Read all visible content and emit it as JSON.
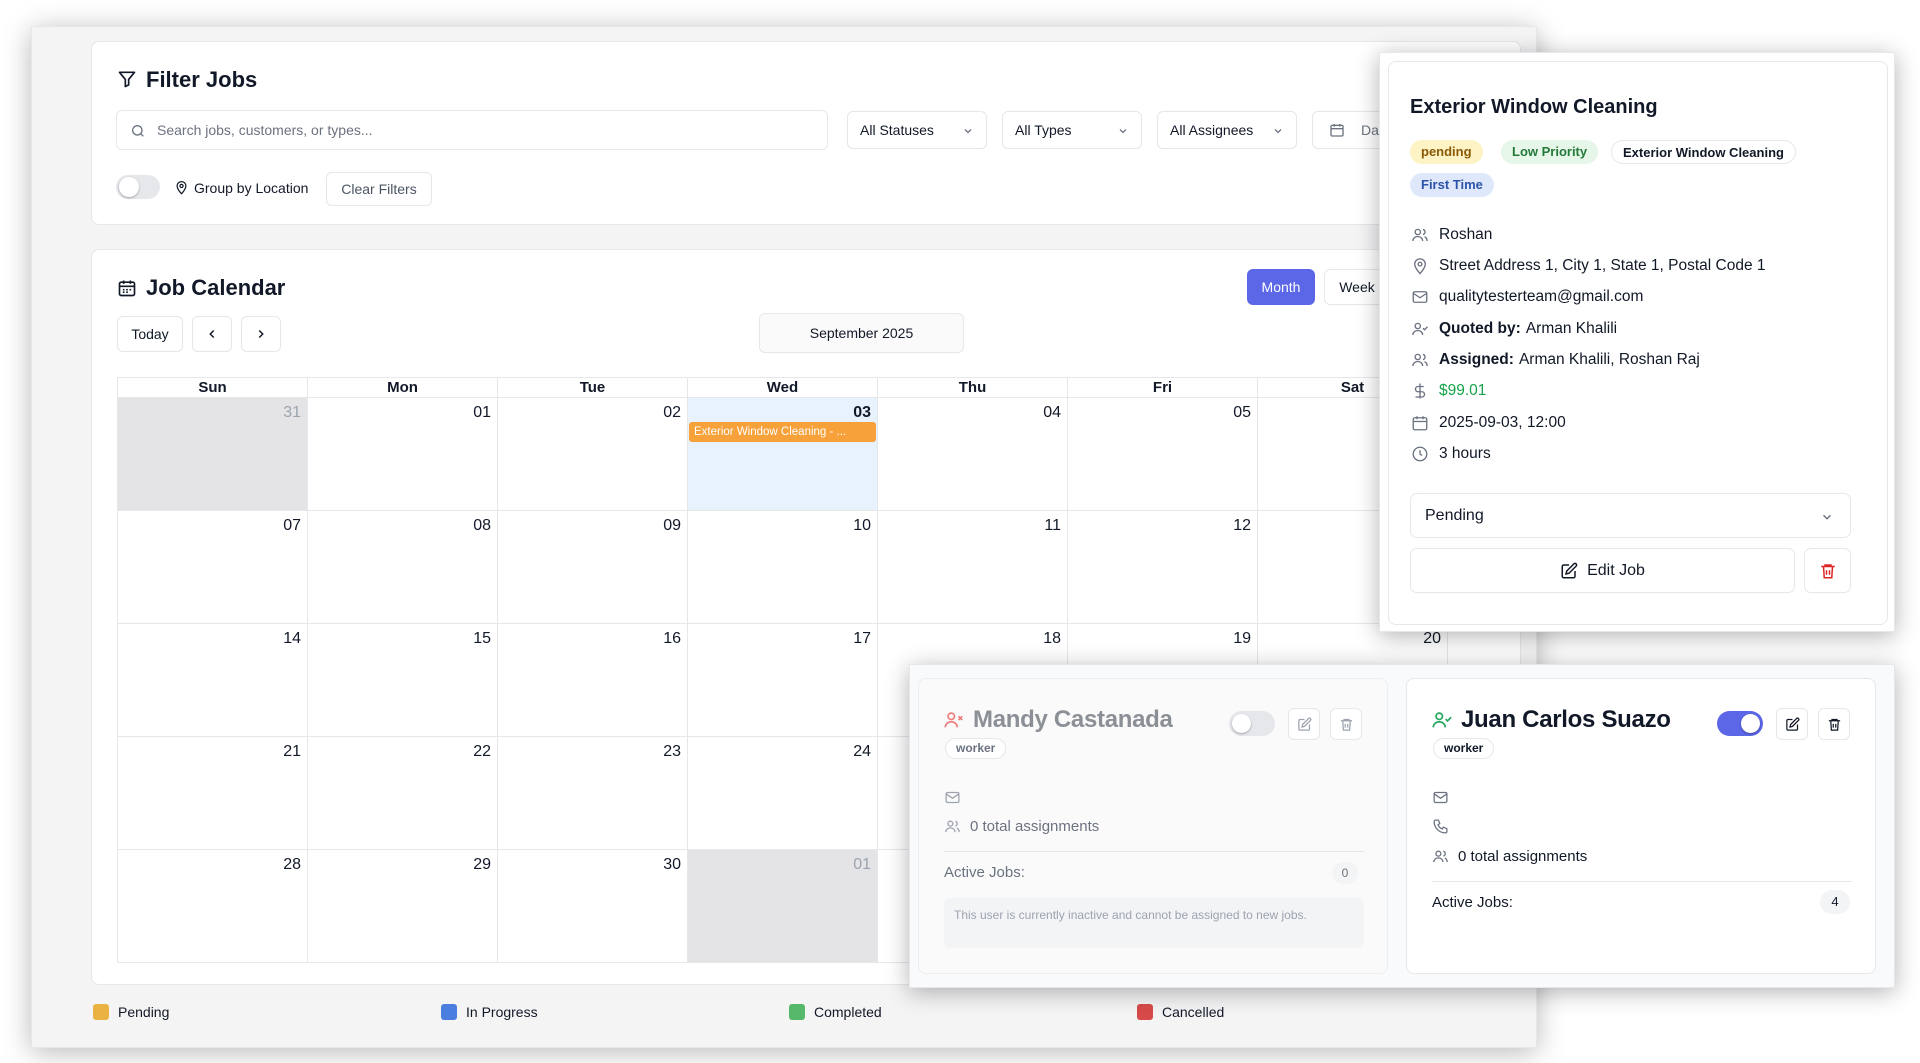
{
  "filter": {
    "title": "Filter Jobs",
    "search_placeholder": "Search jobs, customers, or types...",
    "status_select": "All Statuses",
    "type_select": "All Types",
    "assignee_select": "All Assignees",
    "date_label": "Dat",
    "group_by_label": "Group by Location",
    "clear_label": "Clear Filters"
  },
  "calendar": {
    "title": "Job Calendar",
    "today_label": "Today",
    "month_label": "September 2025",
    "view_month": "Month",
    "view_week": "Week",
    "weekdays": [
      "Sun",
      "Mon",
      "Tue",
      "Wed",
      "Thu",
      "Fri",
      "Sat"
    ],
    "weeks": [
      [
        "31",
        "01",
        "02",
        "03",
        "04",
        "05",
        ""
      ],
      [
        "07",
        "08",
        "09",
        "10",
        "11",
        "12",
        ""
      ],
      [
        "14",
        "15",
        "16",
        "17",
        "18",
        "19",
        "20"
      ],
      [
        "21",
        "22",
        "23",
        "24",
        "",
        "",
        ""
      ],
      [
        "28",
        "29",
        "30",
        "01",
        "",
        "",
        ""
      ]
    ],
    "event_label": "Exterior Window Cleaning - ...",
    "event_color": "#f6a13a"
  },
  "legend": [
    {
      "label": "Pending",
      "color": "#eab243"
    },
    {
      "label": "In Progress",
      "color": "#4a7fe0"
    },
    {
      "label": "Completed",
      "color": "#55b86b"
    },
    {
      "label": "Cancelled",
      "color": "#d94a4a"
    }
  ],
  "job_popover": {
    "title": "Exterior Window Cleaning",
    "badges": [
      "pending",
      "Low Priority",
      "Exterior Window Cleaning",
      "First Time"
    ],
    "customer": "Roshan",
    "address": "Street Address 1, City 1, State 1, Postal Code 1",
    "email": "qualitytesterteam@gmail.com",
    "quoted_by_label": "Quoted by:",
    "quoted_by": "Arman Khalili",
    "assigned_label": "Assigned:",
    "assigned": "Arman Khalili, Roshan Raj",
    "price": "$99.01",
    "datetime": "2025-09-03, 12:00",
    "duration": "3 hours",
    "status_select": "Pending",
    "edit_label": "Edit Job"
  },
  "workers": [
    {
      "name": "Mandy Castanada",
      "role": "worker",
      "assignments": "0 total assignments",
      "active_jobs_label": "Active Jobs:",
      "active_jobs": "0",
      "inactive_note": "This user is currently inactive and cannot be assigned to new jobs."
    },
    {
      "name": "Juan Carlos Suazo",
      "role": "worker",
      "assignments": "0 total assignments",
      "active_jobs_label": "Active Jobs:",
      "active_jobs": "4"
    }
  ],
  "colors": {
    "accent": "#5b67e6",
    "price_green": "#16a34a"
  }
}
